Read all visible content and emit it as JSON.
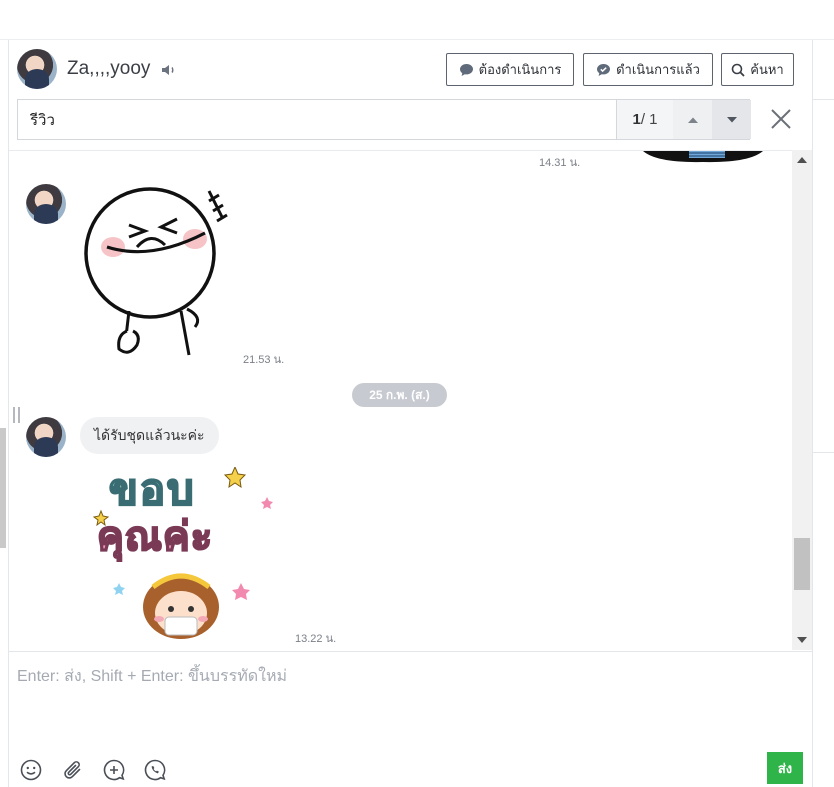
{
  "header": {
    "contact_name": "Za,,,,yooy",
    "btn_todo_label": "ต้องดำเนินการ",
    "btn_done_label": "ดำเนินการแล้ว",
    "btn_search_label": "ค้นหา"
  },
  "search": {
    "query": "รีวิว",
    "current": "1",
    "total": "/ 1"
  },
  "messages": {
    "time_top": "14.31 น.",
    "sticker1_time": "21.53 น.",
    "date_divider": "25 ก.พ. (ส.)",
    "text_message": "ได้รับชุดแล้วนะค่ะ",
    "sticker2_time": "13.22 น.",
    "sticker2_line1": "ขอบ",
    "sticker2_line2": "คุณค่ะ"
  },
  "composer": {
    "placeholder": "Enter: ส่ง, Shift + Enter: ขึ้นบรรทัดใหม่",
    "send_label": "ส่ง"
  },
  "colors": {
    "send_green": "#2fb44a",
    "bubble_gray": "#f0f1f3",
    "date_pill": "#c7cad0"
  },
  "icons": {
    "speaker": "speaker-icon",
    "todo": "chat-bubble-icon",
    "done": "check-bubble-icon",
    "search": "search-icon",
    "close": "close-icon",
    "emoji": "emoji-icon",
    "attach": "paperclip-icon",
    "add_chat": "add-message-icon",
    "call": "phone-bubble-icon"
  }
}
